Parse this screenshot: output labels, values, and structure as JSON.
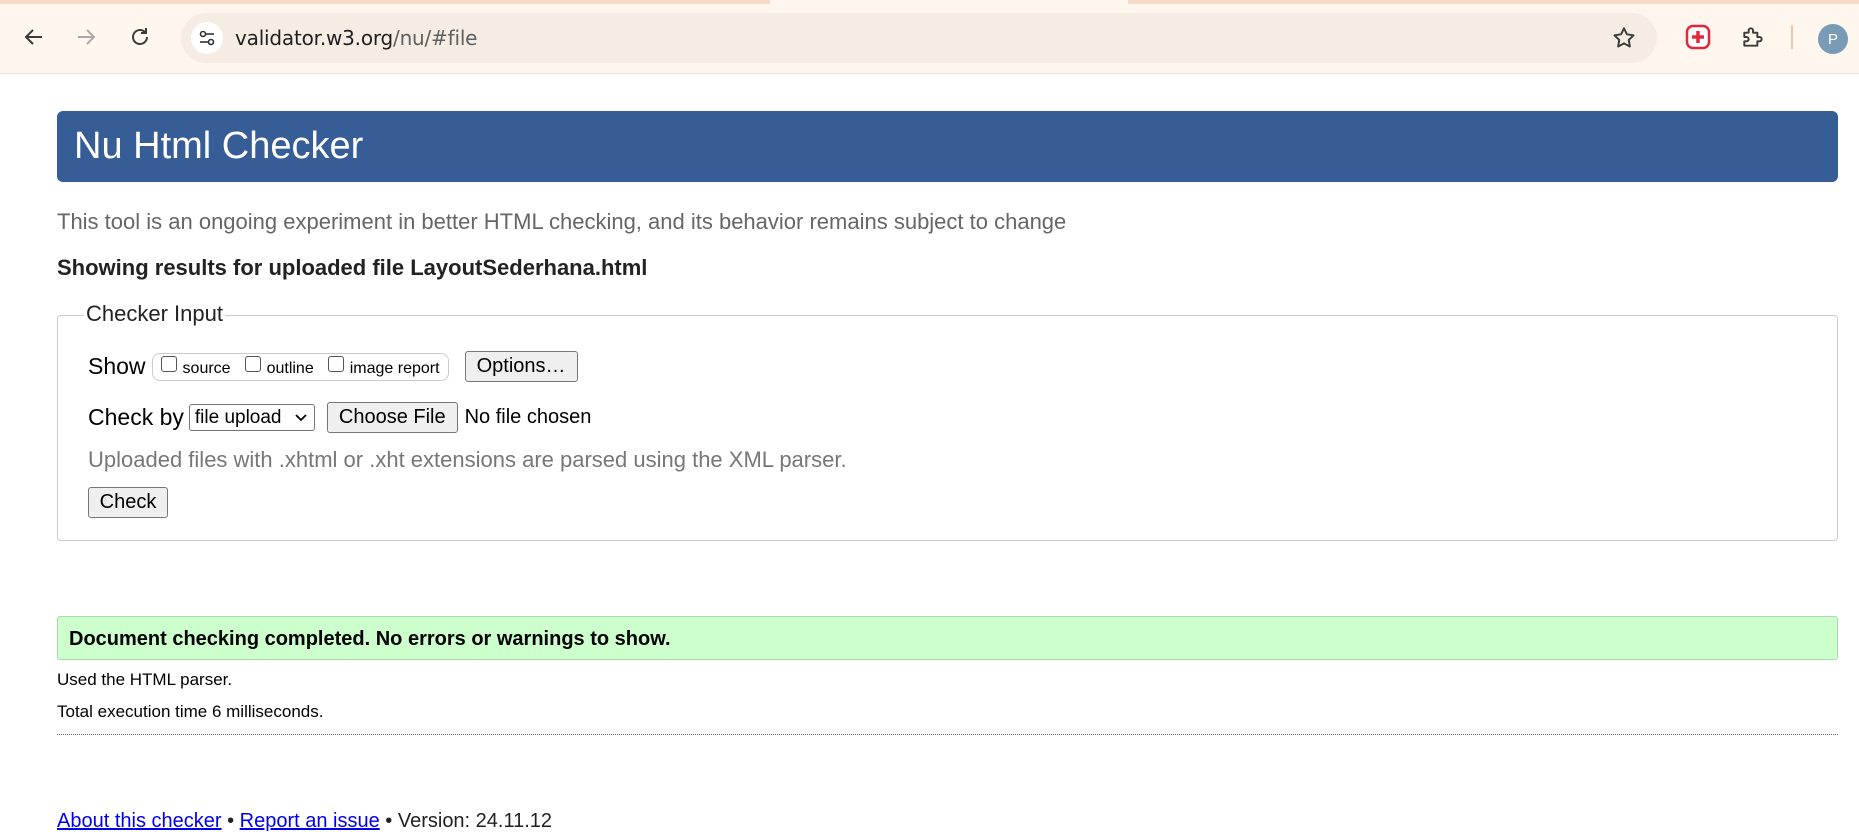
{
  "browser": {
    "url_host": "validator.w3.org",
    "url_path": "/nu/#file",
    "profile_initial": "P"
  },
  "page": {
    "title": "Nu Html Checker",
    "intro": "This tool is an ongoing experiment in better HTML checking, and its behavior remains subject to change",
    "results_for": "Showing results for uploaded file LayoutSederhana.html",
    "checker_input": {
      "legend": "Checker Input",
      "show_label": "Show",
      "show_options": [
        {
          "label": "source",
          "checked": false
        },
        {
          "label": "outline",
          "checked": false
        },
        {
          "label": "image report",
          "checked": false
        }
      ],
      "options_button": "Options…",
      "check_by_label": "Check by",
      "check_by_value": "file upload",
      "choose_file_button": "Choose File",
      "no_file_text": "No file chosen",
      "xml_note": "Uploaded files with .xhtml or .xht extensions are parsed using the XML parser.",
      "check_button": "Check"
    },
    "result": {
      "success_message": "Document checking completed. No errors or warnings to show.",
      "parser_note": "Used the HTML parser.",
      "execution_time": "Total execution time 6 milliseconds."
    },
    "footer": {
      "about_link": "About this checker",
      "bullet1": " • ",
      "report_link": "Report an issue",
      "version_text": " • Version: 24.11.12"
    }
  },
  "colors": {
    "title_bar": "#365d95",
    "success_bg": "#ccffcc",
    "link": "#0000ee"
  }
}
